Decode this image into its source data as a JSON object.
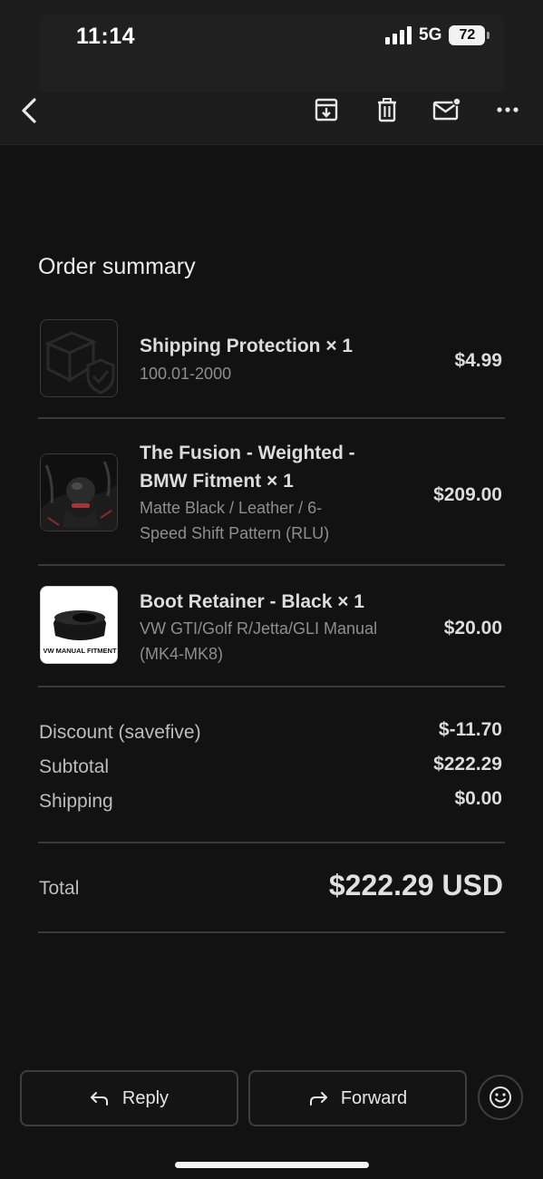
{
  "status": {
    "time": "11:14",
    "network": "5G",
    "battery": "72"
  },
  "toolbar": {
    "icons": [
      "back-icon",
      "archive-icon",
      "trash-icon",
      "mark-unread-icon",
      "more-icon"
    ]
  },
  "order": {
    "title": "Order summary",
    "items": [
      {
        "title": "Shipping Protection × 1",
        "subtitle": "100.01-2000",
        "price": "$4.99"
      },
      {
        "title_line1": "The Fusion - Weighted -",
        "title_line2": "BMW Fitment × 1",
        "subtitle_line1": "Matte Black / Leather / 6-",
        "subtitle_line2": "Speed Shift Pattern (RLU)",
        "price": "$209.00"
      },
      {
        "title": "Boot Retainer - Black × 1",
        "subtitle_line1": "VW GTI/Golf R/Jetta/GLI Manual",
        "subtitle_line2": "(MK4-MK8)",
        "price": "$20.00",
        "image_text": "VW MANUAL FITMENT"
      }
    ],
    "summary": [
      {
        "label": "Discount (savefive)",
        "value": "$-11.70"
      },
      {
        "label": "Subtotal",
        "value": "$222.29"
      },
      {
        "label": "Shipping",
        "value": "$0.00"
      }
    ],
    "total_label": "Total",
    "total_value": "$222.29 USD"
  },
  "actions": {
    "reply": "Reply",
    "forward": "Forward"
  },
  "colors": {
    "background": "#121212",
    "header": "#1c1c1c",
    "divider": "#3a3a3a",
    "text_primary": "#dcdcdc",
    "text_secondary": "#8e8e8e"
  }
}
